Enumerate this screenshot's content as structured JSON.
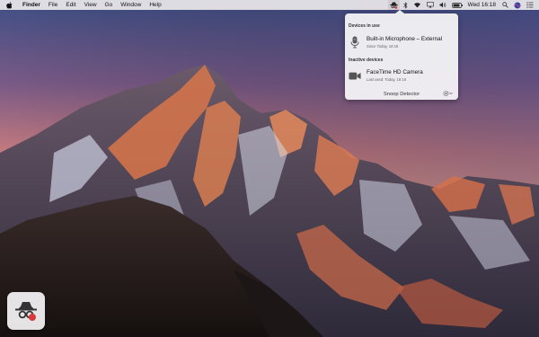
{
  "menubar": {
    "app_name": "Finder",
    "menus": [
      "File",
      "Edit",
      "View",
      "Go",
      "Window",
      "Help"
    ],
    "clock": "Wed 16:18"
  },
  "popover": {
    "in_use_header": "Devices in use",
    "in_use": [
      {
        "name": "Built-in Microphone – External",
        "detail": "Since Today, 16:18",
        "icon": "microphone-icon"
      }
    ],
    "inactive_header": "Inactive devices",
    "inactive": [
      {
        "name": "FaceTime HD Camera",
        "detail": "Last used: Today, 16:18",
        "icon": "camera-icon"
      }
    ],
    "footer_label": "Snoop Detector"
  },
  "colors": {
    "menubar_bg": "#ece9ec",
    "popover_bg": "#f3f1f4",
    "accent_red": "#d9383a"
  }
}
